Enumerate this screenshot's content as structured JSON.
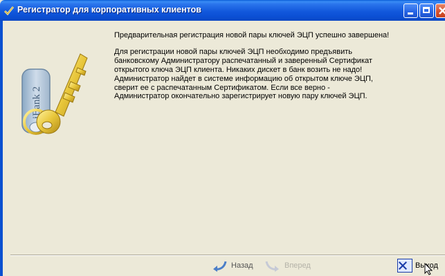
{
  "window": {
    "title": "Регистратор для корпоративных клиентов"
  },
  "illustration": {
    "card_text": "iBank 2"
  },
  "content": {
    "heading": "Предварительная регистрация новой пары ключей ЭЦП успешно завершена!",
    "body_lines": [
      "Для регистрации новой пары ключей ЭЦП необходимо предъявить",
      "банковскому Администратору распечатанный и заверенный Сертификат",
      "открытого ключа ЭЦП клиента. Никаких дискет в банк возить не надо!",
      "Администратор найдет в системе информацию об открытом ключе ЭЦП,",
      "сверит ее с распечатанным Сертификатом. Если все верно -",
      "Администратор окончательно зарегистрирует новую пару ключей ЭЦП."
    ]
  },
  "footer": {
    "back_label": "Назад",
    "next_label": "Вперед",
    "exit_label": "Выход"
  },
  "icons": {
    "title": "checkmark-app-icon",
    "key": "key-icon",
    "back": "back-arrow-icon",
    "next": "forward-arrow-icon",
    "exit": "close-x-icon"
  },
  "colors": {
    "titlebar": "#0b4fd4",
    "window_bg": "#ece9d8",
    "key_gold": "#e8c63a"
  }
}
